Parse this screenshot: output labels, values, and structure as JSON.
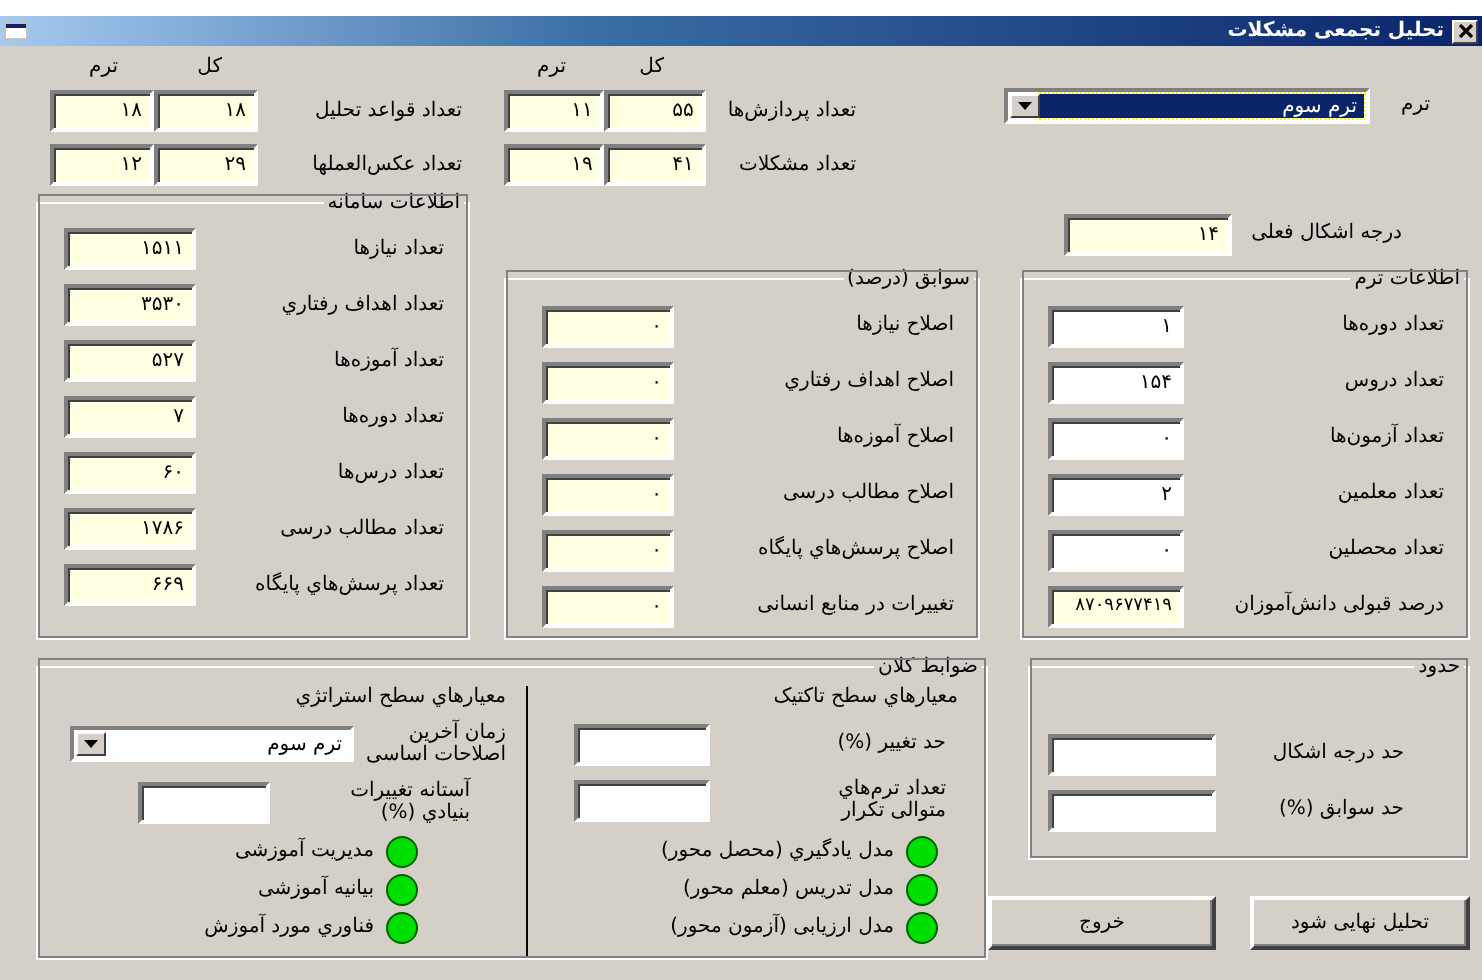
{
  "window": {
    "title": "تحلیل تجمعی مشکلات"
  },
  "term_select": {
    "label": "ترم",
    "value": "ترم سوم",
    "highlighted": true
  },
  "current_defect_degree": {
    "label": "درجه اشکال فعلی",
    "value": "۱۴"
  },
  "pair_blocks": [
    {
      "headers": [
        "کل",
        "ترم"
      ],
      "rows": [
        {
          "label": "تعداد پردازش‌ها",
          "total": "۵۵",
          "term": "۱۱"
        },
        {
          "label": "تعداد مشکلات",
          "total": "۴۱",
          "term": "۱۹"
        }
      ]
    },
    {
      "headers": [
        "کل",
        "ترم"
      ],
      "rows": [
        {
          "label": "تعداد قواعد تحلیل",
          "total": "۱۸",
          "term": "۱۸"
        },
        {
          "label": "تعداد عکس‌العملها",
          "total": "۲۹",
          "term": "۱۲"
        }
      ]
    }
  ],
  "term_info": {
    "title": "اطلاعات ترم",
    "fields": [
      {
        "label": "تعداد دوره‌ها",
        "value": "۱",
        "readonly": false
      },
      {
        "label": "تعداد دروس",
        "value": "۱۵۴",
        "readonly": false
      },
      {
        "label": "تعداد آزمون‌ها",
        "value": "۰",
        "readonly": false
      },
      {
        "label": "تعداد معلمین",
        "value": "۲",
        "readonly": false
      },
      {
        "label": "تعداد محصلین",
        "value": "۰",
        "readonly": false
      },
      {
        "label": "درصد قبولی دانش‌آموزان",
        "value": "۸۷۰۹۶۷۷۴۱۹",
        "readonly": true
      }
    ]
  },
  "history": {
    "title": "سوابق (درصد)",
    "fields": [
      {
        "label": "اصلاح نیازها",
        "value": "۰",
        "readonly": true
      },
      {
        "label": "اصلاح اهداف رفتاري",
        "value": "۰",
        "readonly": true
      },
      {
        "label": "اصلاح آموزه‌ها",
        "value": "۰",
        "readonly": true
      },
      {
        "label": "اصلاح مطالب درسی",
        "value": "۰",
        "readonly": true
      },
      {
        "label": "اصلاح پرسش‌هاي پایگاه",
        "value": "۰",
        "readonly": true
      },
      {
        "label": "تغییرات در منابع انسانی",
        "value": "۰",
        "readonly": true
      }
    ]
  },
  "system_info": {
    "title": "اطلاعات سامانه",
    "fields": [
      {
        "label": "تعداد نیازها",
        "value": "۱۵۱۱",
        "readonly": true
      },
      {
        "label": "تعداد اهداف رفتاري",
        "value": "۳۵۳۰",
        "readonly": true
      },
      {
        "label": "تعداد آموزه‌ها",
        "value": "۵۲۷",
        "readonly": true
      },
      {
        "label": "تعداد دوره‌ها",
        "value": "۷",
        "readonly": true
      },
      {
        "label": "تعداد درس‌ها",
        "value": "۶۰",
        "readonly": true
      },
      {
        "label": "تعداد مطالب درسی",
        "value": "۱۷۸۶",
        "readonly": true
      },
      {
        "label": "تعداد پرسش‌هاي پایگاه",
        "value": "۶۶۹",
        "readonly": true
      }
    ]
  },
  "macro_rules": {
    "title": "ضوابط کلان",
    "tactical": {
      "title": "معیارهاي سطح تاکتیک",
      "fields": [
        {
          "label": "حد تغییر (%)"
        },
        {
          "label": "تعداد ترم‌هاي\nمتوالی تکرار"
        }
      ],
      "indicators": [
        {
          "label": "مدل یادگیري (محصل محور)",
          "color": "#00e000"
        },
        {
          "label": "مدل تدریس (معلم محور)",
          "color": "#00e000"
        },
        {
          "label": "مدل ارزیابی (آزمون محور)",
          "color": "#00e000"
        }
      ]
    },
    "strategic": {
      "title": "معیارهاي سطح استراتژي",
      "last_change": {
        "label": "زمان آخرین\nاصلاحات اساسی",
        "value": "ترم سوم"
      },
      "threshold": {
        "label": "آستانه تغییرات\nبنیادي (%)"
      },
      "indicators": [
        {
          "label": "مدیریت آموزشی",
          "color": "#00e000"
        },
        {
          "label": "بیانیه آموزشی",
          "color": "#00e000"
        },
        {
          "label": "فناوري مورد آموزش",
          "color": "#00e000"
        }
      ]
    }
  },
  "limits": {
    "title": "حدود",
    "fields": [
      {
        "label": "حد درجه اشکال"
      },
      {
        "label": "حد سوابق (%)"
      }
    ]
  },
  "buttons": [
    {
      "label": "تحلیل نهایی شود"
    },
    {
      "label": "خروج"
    }
  ]
}
